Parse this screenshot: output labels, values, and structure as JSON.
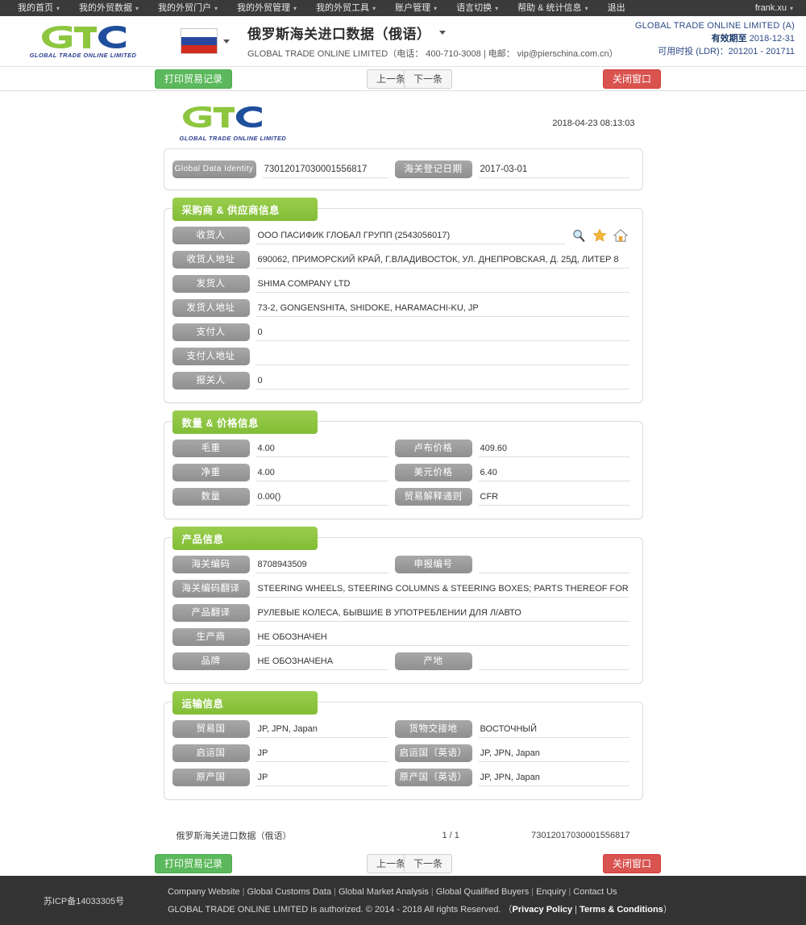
{
  "topnav": {
    "items": [
      {
        "label": "我的首页",
        "caret": true
      },
      {
        "label": "我的外贸数据",
        "caret": true
      },
      {
        "label": "我的外贸门户",
        "caret": true
      },
      {
        "label": "我的外贸管理",
        "caret": true
      },
      {
        "label": "我的外贸工具",
        "caret": true
      },
      {
        "label": "账户管理",
        "caret": true
      },
      {
        "label": "语言切换",
        "caret": true
      },
      {
        "label": "帮助 & 统计信息",
        "caret": true
      },
      {
        "label": "退出",
        "caret": false
      }
    ],
    "user": "frank.xu"
  },
  "header": {
    "logo_text": "GTO",
    "logo_sub": "GLOBAL TRADE ONLINE LIMITED",
    "flag": "russia-flag",
    "title": "俄罗斯海关进口数据（俄语）",
    "subtitle": "GLOBAL TRADE ONLINE LIMITED（电话： 400-710-3008 | 电邮： vip@pierschina.com.cn）",
    "account_name": "GLOBAL TRADE ONLINE LIMITED (A)",
    "valid_label": "有效期至",
    "valid_value": "2018-12-31",
    "ldr_text": "可用时投 (LDR)：201201 - 201711"
  },
  "toolbar": {
    "print_label": "打印贸易记录",
    "prev_label": "上一条",
    "next_label": "下一条",
    "close_label": "关闭窗口",
    "green": "#5cb85c",
    "red": "#d9534f"
  },
  "document": {
    "logo_sub": "GLOBAL TRADE ONLINE LIMITED",
    "timestamp": "2018-04-23 08:13:03",
    "identity": {
      "id_label": "Global Data Identity",
      "id_value": "73012017030001556817",
      "date_label": "海关登记日期",
      "date_value": "2017-03-01"
    },
    "sections": [
      {
        "title": "采购商 & 供应商信息",
        "rows": [
          {
            "label": "收货人",
            "value": "ООО ПАСИФИК ГЛОБАЛ ГРУПП (2543056017)",
            "icons": true
          },
          {
            "label": "收货人地址",
            "value": "690062, ПРИМОРСКИЙ КРАЙ, Г.ВЛАДИВОСТОК, УЛ. ДНЕПРОВСКАЯ, Д. 25Д, ЛИТЕР 8"
          },
          {
            "label": "发货人",
            "value": "SHIMA COMPANY LTD"
          },
          {
            "label": "发货人地址",
            "value": "73-2, GONGENSHITA, SHIDOKE, HARAMACHI-KU, JP"
          },
          {
            "label": "支付人",
            "value": "0"
          },
          {
            "label": "支付人地址",
            "value": ""
          },
          {
            "label": "报关人",
            "value": "0"
          }
        ]
      },
      {
        "title": "数量 & 价格信息",
        "pairs": [
          {
            "label_l": "毛重",
            "value_l": "4.00",
            "label_r": "卢布价格",
            "value_r": "409.60"
          },
          {
            "label_l": "净重",
            "value_l": "4.00",
            "label_r": "美元价格",
            "value_r": "6.40"
          },
          {
            "label_l": "数量",
            "value_l": "0.00()",
            "label_r": "贸易解释通则",
            "value_r": "CFR"
          }
        ]
      },
      {
        "title": "产品信息",
        "pairs": [
          {
            "label_l": "海关编码",
            "value_l": "8708943509",
            "label_r": "申报编号",
            "value_r": ""
          }
        ],
        "rows": [
          {
            "label": "海关编码翻译",
            "value": "STEERING WHEELS, STEERING COLUMNS & STEERING BOXES; PARTS THEREOF FOR TH"
          },
          {
            "label": "产品翻译",
            "value": "РУЛЕВЫЕ КОЛЕСА, БЫВШИЕ В УПОТРЕБЛЕНИИ ДЛЯ Л/АВТО"
          },
          {
            "label": "生产商",
            "value": "НЕ ОБОЗНАЧЕН"
          }
        ],
        "pairs2": [
          {
            "label_l": "品牌",
            "value_l": "НЕ ОБОЗНАЧЕНА",
            "label_r": "产地",
            "value_r": ""
          }
        ]
      },
      {
        "title": "运输信息",
        "pairs": [
          {
            "label_l": "贸易国",
            "value_l": "JP, JPN, Japan",
            "label_r": "货物交接地",
            "value_r": "ВОСТОЧНЫЙ"
          },
          {
            "label_l": "启运国",
            "value_l": "JP",
            "label_r": "启运国（英语）",
            "value_r": "JP, JPN, Japan"
          },
          {
            "label_l": "原产国",
            "value_l": "JP",
            "label_r": "原产国（英语）",
            "value_r": "JP, JPN, Japan"
          }
        ]
      }
    ],
    "footer": {
      "name": "俄罗斯海关进口数据（俄语）",
      "page": "1 / 1",
      "id": "73012017030001556817"
    }
  },
  "icons": {
    "search": "search-icon",
    "star": "star-icon",
    "home": "home-icon"
  },
  "footer": {
    "icp": "苏ICP备14033305号",
    "links": [
      "Company Website",
      "Global Customs Data",
      "Global Market Analysis",
      "Global Qualified Buyers",
      "Enquiry",
      "Contact Us"
    ],
    "copy_prefix": "GLOBAL TRADE ONLINE LIMITED is authorized. © 2014 - 2018 All rights Reserved. （",
    "copy_link1": "Privacy Policy",
    "copy_mid": " | ",
    "copy_link2": "Terms & Conditions",
    "copy_suffix": "）"
  }
}
